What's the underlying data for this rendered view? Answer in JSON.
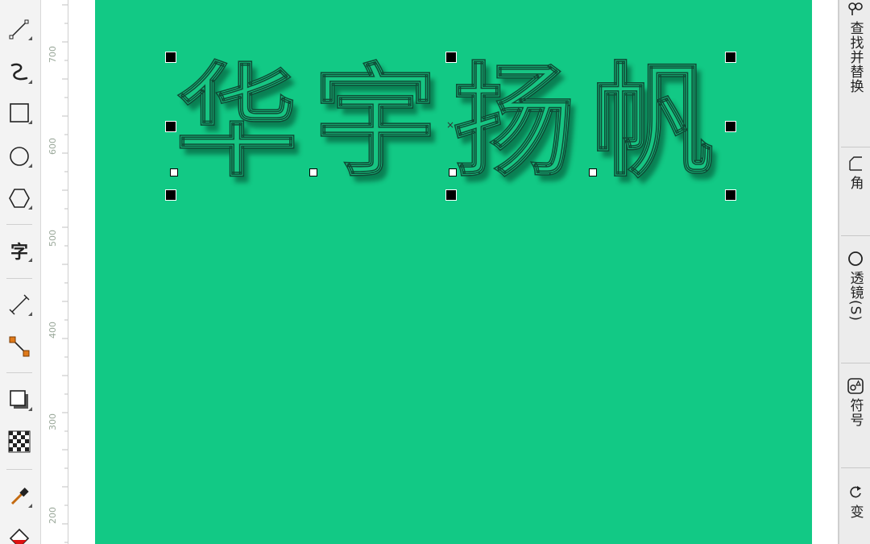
{
  "toolbox": {
    "text_tool_glyph": "字"
  },
  "ruler": {
    "labels": [
      "700",
      "600",
      "500",
      "400",
      "300",
      "200"
    ]
  },
  "canvas": {
    "page_color": "#12c985",
    "art_text": "华宇扬帆",
    "center_marker": "×"
  },
  "docker": {
    "tabs": [
      {
        "label": "查找并替换",
        "icon": "find-replace-icon"
      },
      {
        "label": "角",
        "icon": "corner-icon"
      },
      {
        "label": "透镜(S)",
        "icon": "lens-icon"
      },
      {
        "label": "符号",
        "icon": "symbol-icon"
      },
      {
        "label": "变",
        "icon": "transform-icon"
      }
    ]
  }
}
